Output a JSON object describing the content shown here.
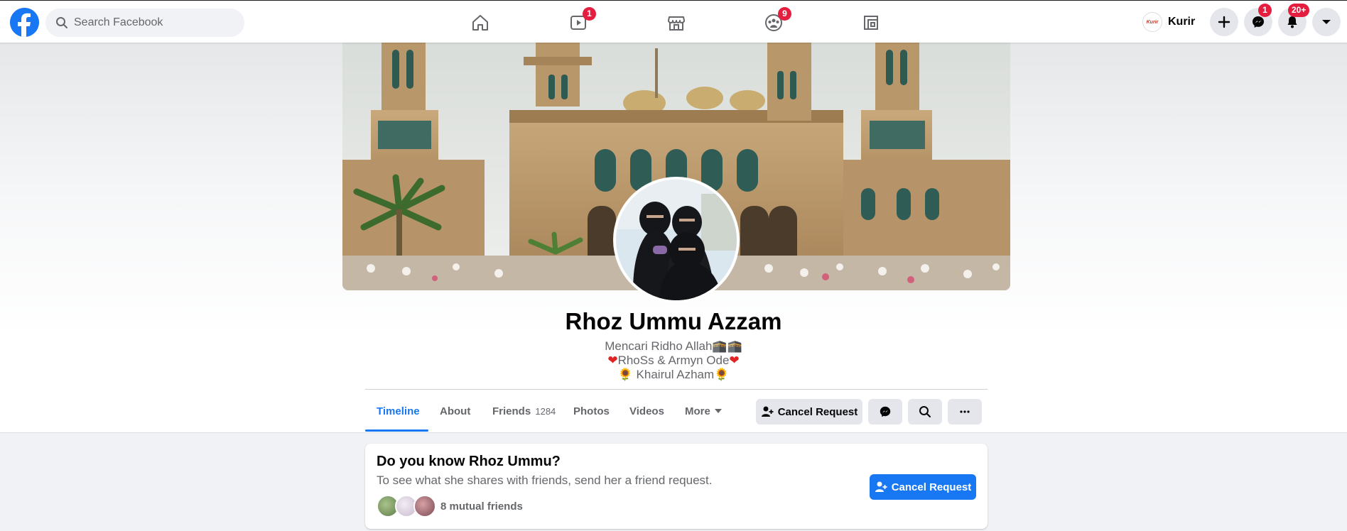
{
  "search": {
    "placeholder": "Search Facebook"
  },
  "nav": {
    "watch_badge": "1",
    "groups_badge": "9"
  },
  "account": {
    "name": "Kurir",
    "avatar_text": "Kurir",
    "messenger_badge": "1",
    "notifications_badge": "20+"
  },
  "profile": {
    "name": "Rhoz Ummu Azzam",
    "bio_line1": "Mencari Ridho Allah🕋🕋",
    "bio_line2_text": "RhoSs & Armyn Ode",
    "bio_line2_heart": "❤",
    "bio_line3_text": " Khairul Azham",
    "bio_line3_flower": "🌻"
  },
  "tabs": [
    {
      "label": "Timeline"
    },
    {
      "label": "About"
    },
    {
      "label": "Friends",
      "count": "1284"
    },
    {
      "label": "Photos"
    },
    {
      "label": "Videos"
    },
    {
      "label": "More"
    }
  ],
  "actions": {
    "cancel_request_label": "Cancel Request"
  },
  "card": {
    "title": "Do you know Rhoz Ummu?",
    "subtitle": "To see what she shares with friends, send her a friend request.",
    "mutual_friends": "8 mutual friends",
    "button_label": "Cancel Request"
  },
  "colors": {
    "brand": "#1877f2",
    "badge": "#e41e3f",
    "text_secondary": "#65676b",
    "button_gray": "#e4e6eb"
  }
}
